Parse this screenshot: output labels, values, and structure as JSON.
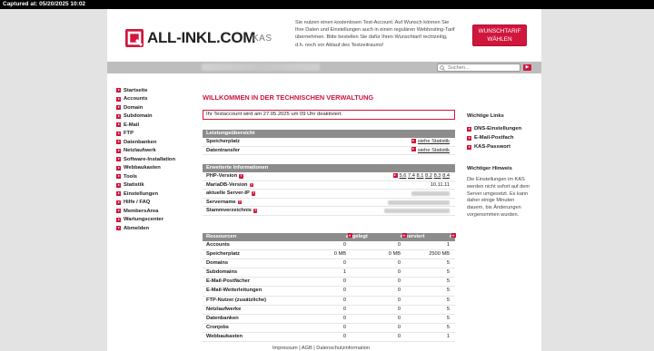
{
  "capture_bar": "Captured at: 05/20/2025 10:02",
  "header": {
    "logo_text": "ALL-INKL.COM",
    "logo_sub": "KAS",
    "note": "Sie nutzen einen kostenlosen Test-Account. Auf Wunsch können Sie Ihre Daten und Einstellungen auch in einen regulären Webhosting-Tarif übernehmen. Bitte bestellen Sie dafür Ihren Wunschtarif rechtzeitig, d.h. noch vor Ablauf des Testzeitraums!",
    "wunsch_line1": "WUNSCHTARIF",
    "wunsch_line2": "WÄHLEN"
  },
  "search": {
    "placeholder": "Suchen..."
  },
  "nav": {
    "items": [
      "Startseite",
      "Accounts",
      "Domain",
      "Subdomain",
      "E-Mail",
      "FTP",
      "Datenbanken",
      "Netzlaufwerk",
      "Software-Installation",
      "Webbaukasten",
      "Tools",
      "Statistik",
      "Einstellungen",
      "Hilfe / FAQ",
      "MembersArea",
      "Wartungscenter",
      "Abmelden"
    ]
  },
  "main": {
    "title": "WILLKOMMEN IN DER TECHNISCHEN VERWALTUNG",
    "notice": "Ihr Testaccount wird am 27.05.2025 um 09 Uhr deaktiviert.",
    "overview": {
      "heading": "Leistungsübersicht",
      "rows": [
        {
          "label": "Speicherplatz",
          "link": "siehe Statistik"
        },
        {
          "label": "Datentransfer",
          "link": "siehe Statistik"
        }
      ]
    },
    "extended": {
      "heading": "Erweiterte Informationen",
      "php_label": "PHP-Version",
      "php_versions": [
        "5.6",
        "7.4",
        "8.1",
        "8.2",
        "8.3",
        "8.4"
      ],
      "mariadb_label": "MariaDB-Version",
      "mariadb_value": "10.11.11",
      "server_ip_label": "aktuelle Server-IP",
      "servername_label": "Servername",
      "stammverzeichnis_label": "Stammverzeichnis"
    },
    "resources": {
      "headers": [
        "Ressourcen",
        "angelegt",
        "reserviert",
        "möglich"
      ],
      "rows": [
        [
          "Accounts",
          "0",
          "0",
          "1"
        ],
        [
          "Speicherplatz",
          "0 MB",
          "0 MB",
          "2500 MB"
        ],
        [
          "Domains",
          "0",
          "0",
          "5"
        ],
        [
          "Subdomains",
          "1",
          "0",
          "5"
        ],
        [
          "E-Mail-Postfächer",
          "0",
          "0",
          "5"
        ],
        [
          "E-Mail-Weiterleitungen",
          "0",
          "0",
          "5"
        ],
        [
          "FTP-Nutzer (zusätzliche)",
          "0",
          "0",
          "5"
        ],
        [
          "Netzlaufwerke",
          "0",
          "0",
          "5"
        ],
        [
          "Datenbanken",
          "0",
          "0",
          "5"
        ],
        [
          "Cronjobs",
          "0",
          "0",
          "5"
        ],
        [
          "Webbaukasten",
          "0",
          "0",
          "1"
        ]
      ]
    }
  },
  "side": {
    "links_heading": "Wichtige Links",
    "links": [
      "DNS-Einstellungen",
      "E-Mail-Postfach",
      "KAS-Passwort"
    ],
    "hint_heading": "Wichtiger Hinweis",
    "hint_text": "Die Einstellungen im KAS werden nicht sofort auf dem Server umgesetzt. Es kann daher einige Minuten dauern, bis Änderungen vorgenommen wurden."
  },
  "footer": {
    "links": "Impressum | AGB | Datenschutzinformation"
  },
  "colors": {
    "accent": "#d0163d",
    "header_bar": "#8c8c8c",
    "background": "#e3e3e3"
  }
}
